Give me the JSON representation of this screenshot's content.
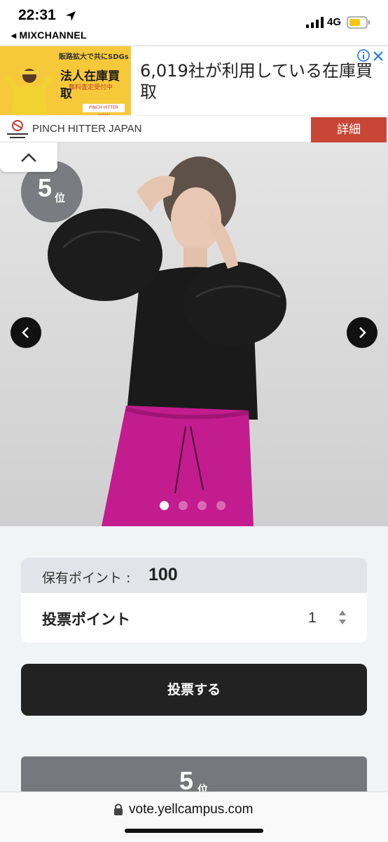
{
  "status_bar": {
    "time": "22:31",
    "back_app": "◂ MIXCHANNEL",
    "network": "4G"
  },
  "ad": {
    "image_tagline": "販路拡大で共にSDGs",
    "image_title": "法人在庫買取",
    "image_sub": "無料査定受付中",
    "image_logo": "PINCH HITTER JAPAN",
    "headline": "6,019社が利用している在庫買取",
    "brand": "PINCH HITTER JAPAN",
    "brand_logo_text": "PINCH HITTER JAPAN",
    "detail_label": "詳細"
  },
  "hero": {
    "rank_number": "5",
    "rank_unit": "位",
    "slide_count": 4,
    "active_slide": 1
  },
  "vote": {
    "owned_label": "保有ポイント :",
    "owned_value": "100",
    "vote_label": "投票ポイント",
    "vote_quantity": "1",
    "submit_label": "投票する"
  },
  "rank_card": {
    "number": "5",
    "unit": "位"
  },
  "browser": {
    "url": "vote.yellcampus.com"
  },
  "colors": {
    "accent_dark": "#222222",
    "badge_gray": "#7b7c81",
    "ad_red": "#c74636",
    "background": "#f2f3f7"
  }
}
